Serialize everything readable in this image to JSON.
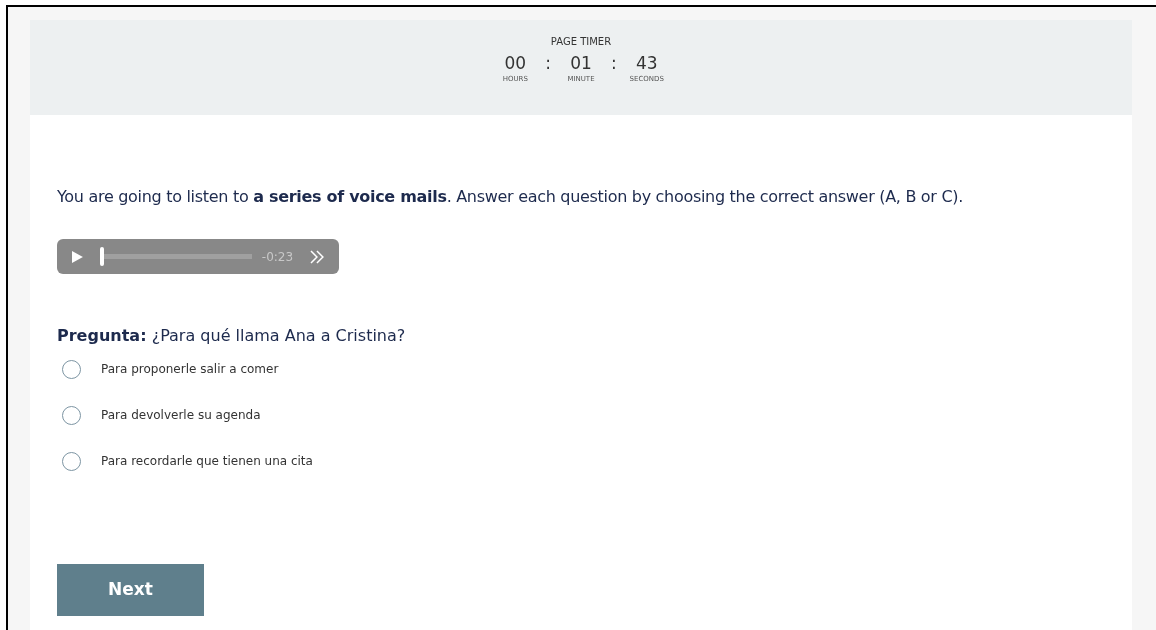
{
  "timer": {
    "title": "PAGE TIMER",
    "units": [
      {
        "value": "00",
        "label": "HOURS"
      },
      {
        "value": "01",
        "label": "MINUTE"
      },
      {
        "value": "43",
        "label": "SECONDS"
      }
    ],
    "separator": ":"
  },
  "instructions": "You are going to listen to **a series of voice mails**. Answer each question by choosing the correct answer (A, B or C).",
  "audio": {
    "level": 0.0,
    "time": "-0:23"
  },
  "question": {
    "label": "Pregunta:",
    "text": "¿Para qué llama Ana a Cristina?"
  },
  "options": [
    {
      "label": "Para proponerle salir a comer",
      "selected": false
    },
    {
      "label": "Para devolverle su agenda",
      "selected": false
    },
    {
      "label": "Para recordarle que tienen una cita",
      "selected": false
    }
  ],
  "next_button": "Next"
}
